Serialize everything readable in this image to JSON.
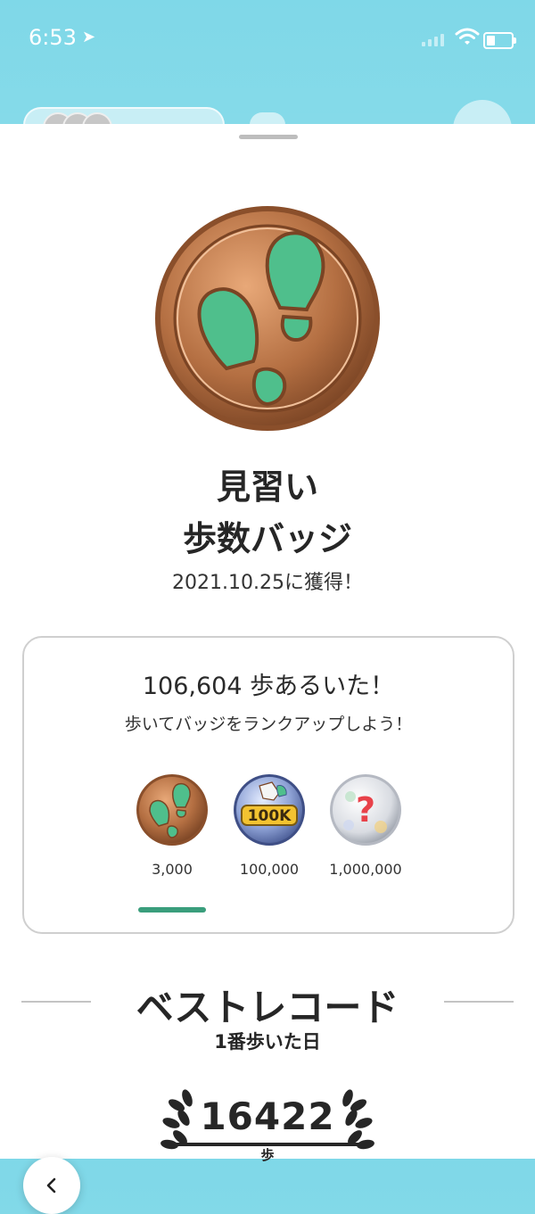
{
  "status_bar": {
    "time": "6:53",
    "location_icon": "location-arrow-icon",
    "signal_icon": "cellular-signal-icon",
    "wifi_icon": "wifi-icon",
    "battery_icon": "battery-icon"
  },
  "badge": {
    "icon": "footprints-bronze-badge-icon",
    "rank_name": "見習い",
    "badge_name": "歩数バッジ",
    "acquired": "2021.10.25に獲得！"
  },
  "progress_card": {
    "steps_text": "106,604 歩あるいた！",
    "rankup_text": "歩いてバッジをランクアップしよう！",
    "tiers": [
      {
        "icon": "bronze-footprints-badge-icon",
        "label": "3,000"
      },
      {
        "icon": "silver-100k-badge-icon",
        "label": "100,000"
      },
      {
        "icon": "locked-question-badge-icon",
        "label": "1,000,000"
      }
    ],
    "selected_tier": "3,000"
  },
  "best_record": {
    "title": "ベストレコード",
    "subtitle": "1番歩いた日",
    "value": "16422",
    "unit": "歩",
    "icon": "laurel-wreath-icon"
  },
  "navigation": {
    "back_icon": "chevron-left-icon"
  },
  "colors": {
    "accent_green": "#3a9e7c",
    "bronze": "#b97748",
    "badge_green": "#4fbf8c"
  }
}
